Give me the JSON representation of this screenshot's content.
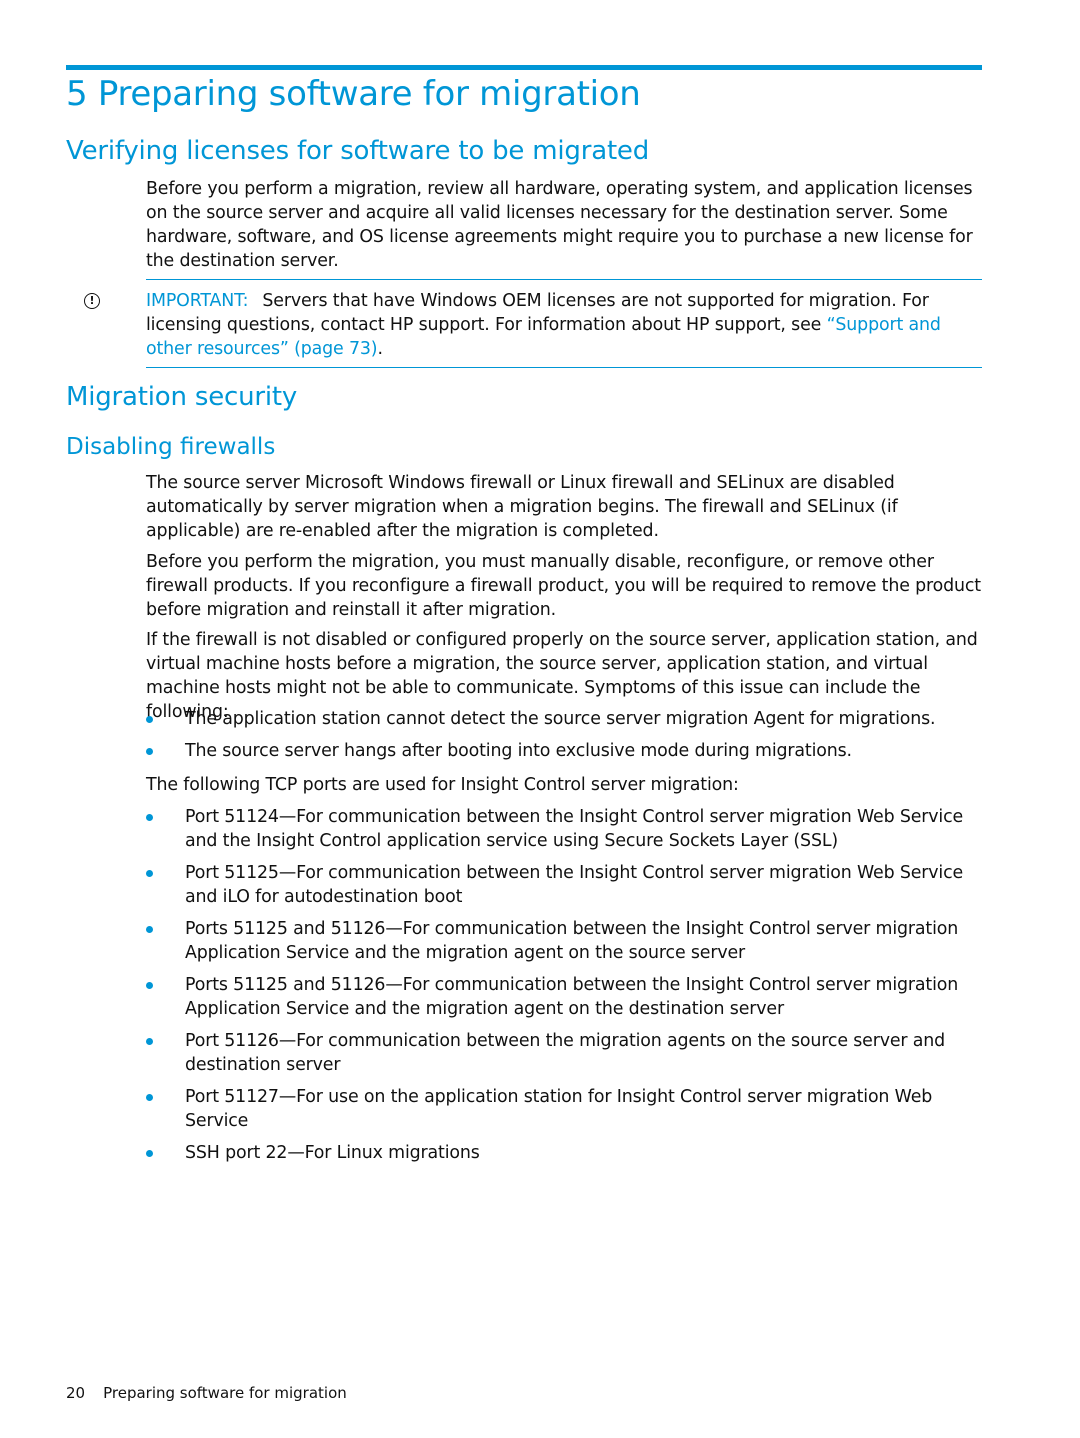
{
  "chapter": {
    "title": "5 Preparing software for migration"
  },
  "section_licenses": {
    "heading": "Verifying licenses for software to be migrated",
    "paragraph": "Before you perform a migration, review all hardware, operating system, and application licenses on the source server and acquire all valid licenses necessary for the destination server. Some hardware, software, and OS license agreements might require you to purchase a new license for the destination server.",
    "note": {
      "icon": "important-icon",
      "label": "IMPORTANT:",
      "text": "Servers that have Windows OEM licenses are not supported for migration. For licensing questions, contact HP support. For information about HP support, see ",
      "link_text": "“Support and other resources” (page 73)",
      "suffix": "."
    }
  },
  "section_security": {
    "heading": "Migration security",
    "subheading": "Disabling firewalls",
    "paragraphs": [
      "The source server Microsoft Windows firewall or Linux firewall and SELinux are disabled automatically by server migration when a migration begins. The firewall and SELinux (if applicable) are re-enabled after the migration is completed.",
      "Before you perform the migration, you must manually disable, reconfigure, or remove other firewall products. If you reconfigure a firewall product, you will be required to remove the product before migration and reinstall it after migration.",
      "If the firewall is not disabled or configured properly on the source server, application station, and virtual machine hosts before a migration, the source server, application station, and virtual machine hosts might not be able to communicate. Symptoms of this issue can include the following:"
    ],
    "symptoms": [
      "The application station cannot detect the source server migration Agent for migrations.",
      "The source server hangs after booting into exclusive mode during migrations."
    ],
    "ports_intro": "The following TCP ports are used for Insight Control server migration:",
    "ports": [
      "Port 51124—For communication between the Insight Control server migration Web Service and the Insight Control application service using Secure Sockets Layer (SSL)",
      "Port 51125—For communication between the Insight Control server migration Web Service and iLO for autodestination boot",
      "Ports 51125 and 51126—For communication between the Insight Control server migration Application Service and the migration agent on the source server",
      "Ports 51125 and 51126—For communication between the Insight Control server migration Application Service and the migration agent on the destination server",
      "Port 51126—For communication between the migration agents on the source server and destination server",
      "Port 51127—For use on the application station for Insight Control server migration Web Service",
      "SSH port 22—For Linux migrations"
    ]
  },
  "footer": {
    "page_number": "20",
    "title": "Preparing software for migration"
  }
}
